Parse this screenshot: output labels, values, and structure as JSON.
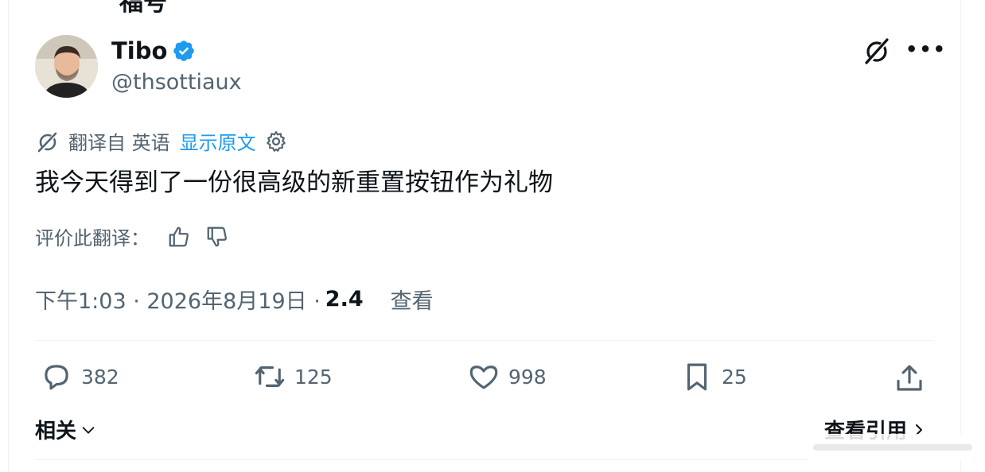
{
  "header": {
    "cut_heading": "福号"
  },
  "author": {
    "name": "Tibo",
    "handle": "@thsottiaux"
  },
  "translation": {
    "from_label": "翻译自 英语",
    "show_original": "显示原文"
  },
  "tweet": {
    "text": "我今天得到了一份很高级的新重置按钮作为礼物"
  },
  "rate": {
    "label": "评价此翻译："
  },
  "meta": {
    "time_date": "下午1:03 · 2026年8月19日 · ",
    "views": "2.4",
    "views_label": "查看"
  },
  "actions": {
    "replies": "382",
    "reposts": "125",
    "likes": "998",
    "bookmarks": "25"
  },
  "footer": {
    "related": "相关",
    "view_quotes": "查看引用"
  },
  "colors": {
    "accent": "#1d9bf0",
    "secondary_text": "#536471",
    "primary_text": "#0f1419"
  }
}
